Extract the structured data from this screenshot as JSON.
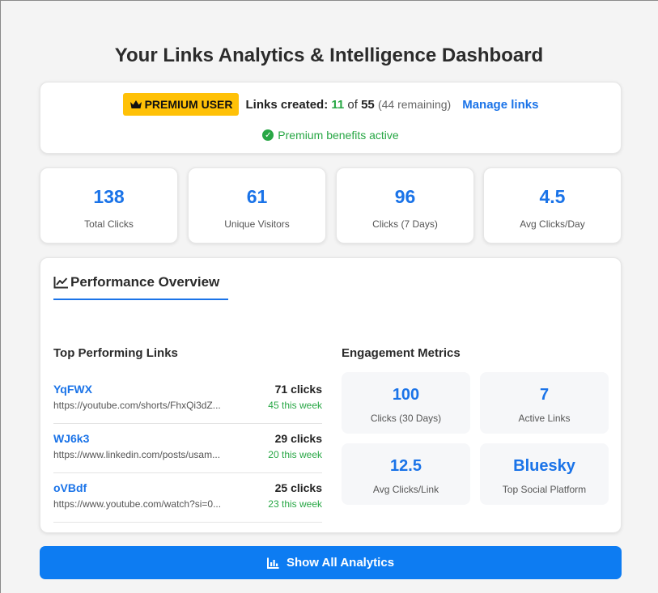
{
  "page_title": "Your Links Analytics & Intelligence Dashboard",
  "premium": {
    "badge": "PREMIUM USER",
    "links_created_label": "Links created:",
    "created_count": "11",
    "of": "of",
    "total": "55",
    "remaining": "(44 remaining)",
    "manage_link": "Manage links",
    "benefits": "Premium benefits active"
  },
  "stats": [
    {
      "value": "138",
      "label": "Total Clicks"
    },
    {
      "value": "61",
      "label": "Unique Visitors"
    },
    {
      "value": "96",
      "label": "Clicks (7 Days)"
    },
    {
      "value": "4.5",
      "label": "Avg Clicks/Day"
    }
  ],
  "performance": {
    "tab_label": "Performance Overview",
    "top_links_title": "Top Performing Links",
    "engagement_title": "Engagement Metrics",
    "links": [
      {
        "code": "YqFWX",
        "url": "https://youtube.com/shorts/FhxQi3dZ...",
        "clicks": "71 clicks",
        "week": "45 this week"
      },
      {
        "code": "WJ6k3",
        "url": "https://www.linkedin.com/posts/usam...",
        "clicks": "29 clicks",
        "week": "20 this week"
      },
      {
        "code": "oVBdf",
        "url": "https://www.youtube.com/watch?si=0...",
        "clicks": "25 clicks",
        "week": "23 this week"
      }
    ],
    "metrics": [
      {
        "value": "100",
        "label": "Clicks (30 Days)"
      },
      {
        "value": "7",
        "label": "Active Links"
      },
      {
        "value": "12.5",
        "label": "Avg Clicks/Link"
      },
      {
        "value": "Bluesky",
        "label": "Top Social Platform"
      }
    ]
  },
  "show_all_button": "Show All Analytics",
  "colors": {
    "accent": "#1a73e8",
    "button": "#0d7cf2",
    "badge": "#ffc107",
    "success": "#28a745"
  },
  "icons": {
    "badge": "crown-icon",
    "benefits": "check-circle-icon",
    "tab": "line-chart-icon",
    "button": "bar-chart-icon"
  }
}
